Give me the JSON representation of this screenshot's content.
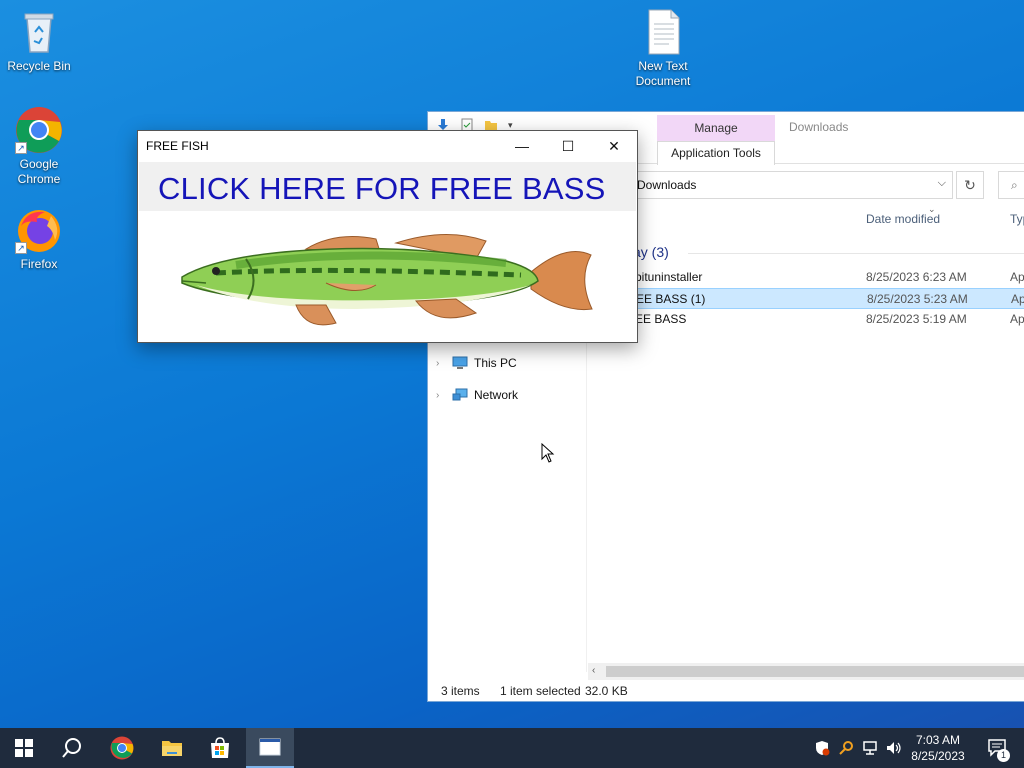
{
  "desktop": {
    "icons": [
      {
        "label": "Recycle Bin"
      },
      {
        "label": "Google Chrome"
      },
      {
        "label": "Firefox"
      },
      {
        "label": "New Text Document"
      }
    ]
  },
  "explorer": {
    "ribbon": {
      "manage_tab": "Manage",
      "window_title": "Downloads",
      "app_tools_tab": "Application Tools"
    },
    "address": {
      "path": "Downloads"
    },
    "columns": {
      "date_modified": "Date modified",
      "type": "Typ"
    },
    "group": {
      "label": "ay (3)"
    },
    "files": [
      {
        "name": "bituninstaller",
        "date": "8/25/2023 6:23 AM",
        "type": "Ap"
      },
      {
        "name": "EE BASS (1)",
        "date": "8/25/2023 5:23 AM",
        "type": "Ap",
        "selected": true
      },
      {
        "name": "EE BASS",
        "date": "8/25/2023 5:19 AM",
        "type": "Ap"
      }
    ],
    "nav": [
      {
        "label": "This PC"
      },
      {
        "label": "Network"
      }
    ],
    "status": {
      "items": "3 items",
      "selection": "1 item selected",
      "size": "32.0 KB"
    }
  },
  "popup": {
    "title": "FREE FISH",
    "banner": "CLICK HERE FOR FREE BASS"
  },
  "taskbar": {
    "time": "7:03 AM",
    "date": "8/25/2023",
    "notification_count": "1"
  },
  "colors": {
    "banner_text": "#1515b8",
    "selection": "#cce8ff",
    "manage_tab": "#f2d7f7",
    "taskbar": "#1f2b3d"
  }
}
